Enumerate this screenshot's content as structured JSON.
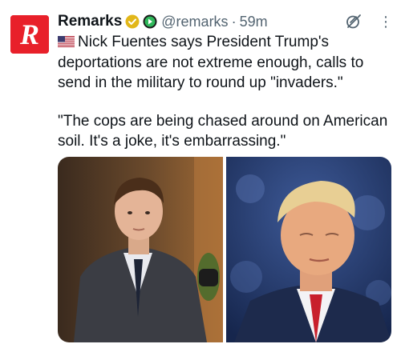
{
  "tweet": {
    "account_name": "Remarks",
    "handle": "@remarks",
    "separator": "·",
    "time": "59m",
    "more_label": "⋮",
    "line1": "Nick Fuentes says President Trump's deportations are not extreme enough, calls to send in the military to round up \"invaders.\"",
    "line2": "\"The cops are being chased around on American soil. It's a joke, it's embarrassing.\""
  },
  "icons": {
    "avatar": "remarks-logo",
    "verified": "gold-verified-badge",
    "affiliate": "affiliate-badge",
    "flag": "us-flag",
    "grok": "grok-icon",
    "more": "more-icon"
  },
  "colors": {
    "brand_red": "#e8202a",
    "verified_gold": "#e2b719",
    "text": "#0f1419",
    "secondary_text": "#536471"
  }
}
